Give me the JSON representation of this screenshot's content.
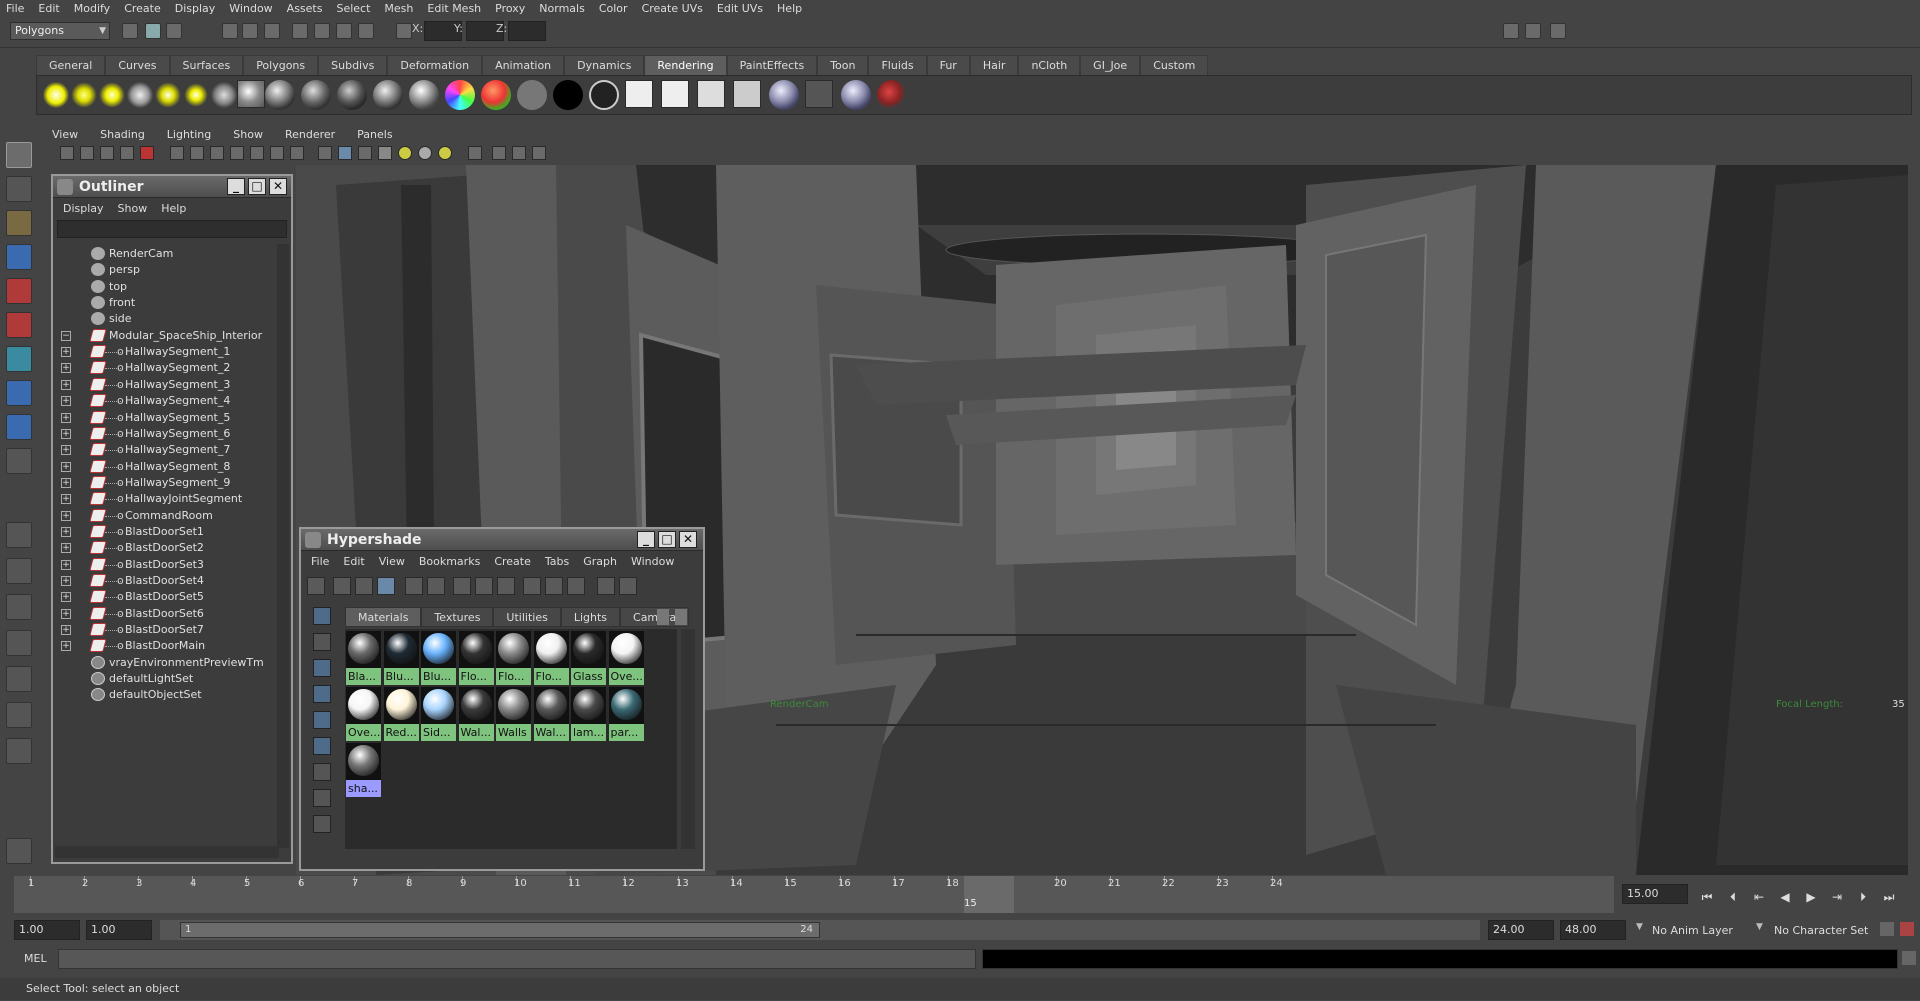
{
  "menubar": [
    "File",
    "Edit",
    "Modify",
    "Create",
    "Display",
    "Window",
    "Assets",
    "Select",
    "Mesh",
    "Edit Mesh",
    "Proxy",
    "Normals",
    "Color",
    "Create UVs",
    "Edit UVs",
    "Help"
  ],
  "status": {
    "mode": "Polygons",
    "x_label": "X:",
    "y_label": "Y:",
    "z_label": "Z:"
  },
  "shelf_tabs": [
    "General",
    "Curves",
    "Surfaces",
    "Polygons",
    "Subdivs",
    "Deformation",
    "Animation",
    "Dynamics",
    "Rendering",
    "PaintEffects",
    "Toon",
    "Fluids",
    "Fur",
    "Hair",
    "nCloth",
    "GI_Joe",
    "Custom"
  ],
  "shelf_active": "Rendering",
  "panel_menu": [
    "View",
    "Shading",
    "Lighting",
    "Show",
    "Renderer",
    "Panels"
  ],
  "viewport": {
    "focal_label": "Focal Length:",
    "focal_value": "35",
    "camera_label": "RenderCam"
  },
  "outliner": {
    "title": "Outliner",
    "menu": [
      "Display",
      "Show",
      "Help"
    ],
    "items": [
      {
        "label": "RenderCam",
        "type": "camera",
        "indent": 0,
        "expand": false
      },
      {
        "label": "persp",
        "type": "camera",
        "indent": 0,
        "expand": false
      },
      {
        "label": "top",
        "type": "camera",
        "indent": 0,
        "expand": false
      },
      {
        "label": "front",
        "type": "camera",
        "indent": 0,
        "expand": false
      },
      {
        "label": "side",
        "type": "camera",
        "indent": 0,
        "expand": false
      },
      {
        "label": "Modular_SpaceShip_Interior",
        "type": "mesh",
        "indent": 0,
        "expand": "minus"
      },
      {
        "label": "HallwaySegment_1",
        "type": "mesh",
        "indent": 1,
        "expand": "plus"
      },
      {
        "label": "HallwaySegment_2",
        "type": "mesh",
        "indent": 1,
        "expand": "plus"
      },
      {
        "label": "HallwaySegment_3",
        "type": "mesh",
        "indent": 1,
        "expand": "plus"
      },
      {
        "label": "HallwaySegment_4",
        "type": "mesh",
        "indent": 1,
        "expand": "plus"
      },
      {
        "label": "HallwaySegment_5",
        "type": "mesh",
        "indent": 1,
        "expand": "plus"
      },
      {
        "label": "HallwaySegment_6",
        "type": "mesh",
        "indent": 1,
        "expand": "plus"
      },
      {
        "label": "HallwaySegment_7",
        "type": "mesh",
        "indent": 1,
        "expand": "plus"
      },
      {
        "label": "HallwaySegment_8",
        "type": "mesh",
        "indent": 1,
        "expand": "plus"
      },
      {
        "label": "HallwaySegment_9",
        "type": "mesh",
        "indent": 1,
        "expand": "plus"
      },
      {
        "label": "HallwayJointSegment",
        "type": "mesh",
        "indent": 1,
        "expand": "plus"
      },
      {
        "label": "CommandRoom",
        "type": "mesh",
        "indent": 1,
        "expand": "plus"
      },
      {
        "label": "BlastDoorSet1",
        "type": "mesh",
        "indent": 1,
        "expand": "plus"
      },
      {
        "label": "BlastDoorSet2",
        "type": "mesh",
        "indent": 1,
        "expand": "plus"
      },
      {
        "label": "BlastDoorSet3",
        "type": "mesh",
        "indent": 1,
        "expand": "plus"
      },
      {
        "label": "BlastDoorSet4",
        "type": "mesh",
        "indent": 1,
        "expand": "plus"
      },
      {
        "label": "BlastDoorSet5",
        "type": "mesh",
        "indent": 1,
        "expand": "plus"
      },
      {
        "label": "BlastDoorSet6",
        "type": "mesh",
        "indent": 1,
        "expand": "plus"
      },
      {
        "label": "BlastDoorSet7",
        "type": "mesh",
        "indent": 1,
        "expand": "plus"
      },
      {
        "label": "BlastDoorMain",
        "type": "mesh",
        "indent": 1,
        "expand": "plus"
      },
      {
        "label": "vrayEnvironmentPreviewTm",
        "type": "set",
        "indent": 0,
        "expand": false
      },
      {
        "label": "defaultLightSet",
        "type": "set",
        "indent": 0,
        "expand": false
      },
      {
        "label": "defaultObjectSet",
        "type": "set",
        "indent": 0,
        "expand": false
      }
    ]
  },
  "hypershade": {
    "title": "Hypershade",
    "menu": [
      "File",
      "Edit",
      "View",
      "Bookmarks",
      "Create",
      "Tabs",
      "Graph",
      "Window"
    ],
    "tabs": [
      "Materials",
      "Textures",
      "Utilities",
      "Lights",
      "Camera"
    ],
    "active_tab": "Materials",
    "swatches": [
      {
        "label": "Bla...",
        "color": "#6a6a6a",
        "row": 0,
        "col": 0
      },
      {
        "label": "Blu...",
        "color": "#1e2a34",
        "row": 0,
        "col": 1
      },
      {
        "label": "Blu...",
        "color": "#6ab4ff",
        "row": 0,
        "col": 2
      },
      {
        "label": "Flo...",
        "color": "#333333",
        "row": 0,
        "col": 3
      },
      {
        "label": "Flo...",
        "color": "#8a8a8a",
        "row": 0,
        "col": 4
      },
      {
        "label": "Flo...",
        "color": "#f0f0f0",
        "row": 0,
        "col": 5
      },
      {
        "label": "Glass",
        "color": "#2a2a2a",
        "row": 0,
        "col": 6
      },
      {
        "label": "Ove...",
        "color": "#f4f4f4",
        "row": 0,
        "col": 7
      },
      {
        "label": "Ove...",
        "color": "#f6f6f6",
        "row": 1,
        "col": 0
      },
      {
        "label": "Red...",
        "color": "#fff4d8",
        "row": 1,
        "col": 1
      },
      {
        "label": "Sid...",
        "color": "#a8d4ff",
        "row": 1,
        "col": 2
      },
      {
        "label": "Wal...",
        "color": "#3a3a3a",
        "row": 1,
        "col": 3
      },
      {
        "label": "Walls",
        "color": "#8c8c8c",
        "row": 1,
        "col": 4
      },
      {
        "label": "Wal...",
        "color": "#5a5a5a",
        "row": 1,
        "col": 5
      },
      {
        "label": "lam...",
        "color": "#4a4a4a",
        "row": 1,
        "col": 6
      },
      {
        "label": "par...",
        "color": "#3a6a74",
        "row": 1,
        "col": 7
      },
      {
        "label": "sha...",
        "color": "#777777",
        "row": 2,
        "col": 0,
        "selected": true
      }
    ]
  },
  "timeline": {
    "ticks": [
      "1",
      "2",
      "3",
      "4",
      "5",
      "6",
      "7",
      "8",
      "9",
      "10",
      "11",
      "12",
      "13",
      "14",
      "15",
      "16",
      "17",
      "18",
      "19",
      "20",
      "21",
      "22",
      "23",
      "24"
    ],
    "current_frame": "15",
    "current_field": "15.00"
  },
  "range": {
    "start": "1.00",
    "start2": "1.00",
    "slider_start": "1",
    "slider_end": "24",
    "end": "24.00",
    "end2": "48.00",
    "anim_layer": "No Anim Layer",
    "char_set": "No Character Set"
  },
  "command": {
    "label": "MEL"
  },
  "help_line": "Select Tool: select an object",
  "colors": {
    "ui_bg": "#444444",
    "swatch_label": "#7ec47e",
    "swatch_selected": "#9a9aff"
  }
}
